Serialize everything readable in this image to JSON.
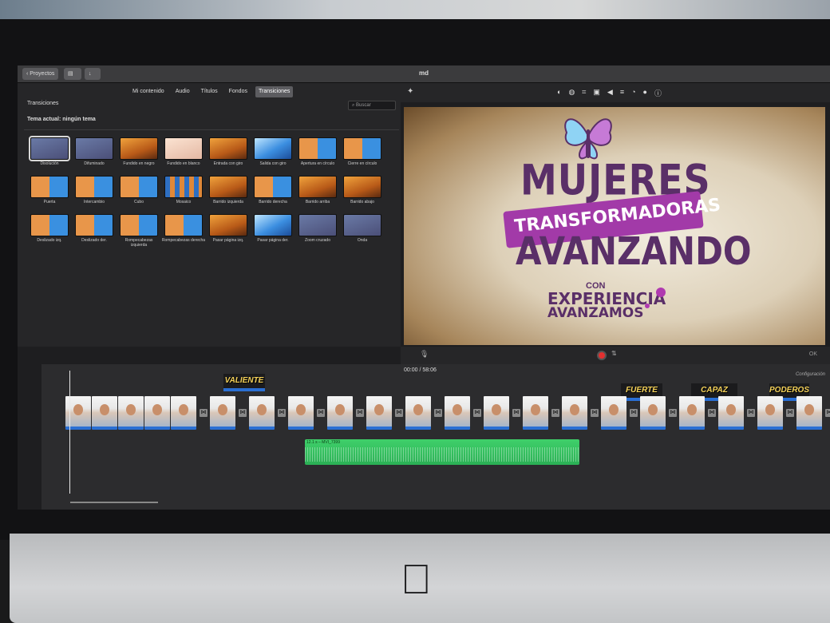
{
  "window": {
    "back_button": "Proyectos",
    "title": "md"
  },
  "browser": {
    "tabs": [
      "Mi contenido",
      "Audio",
      "Títulos",
      "Fondos",
      "Transiciones"
    ],
    "active_tab": "Transiciones",
    "section_title": "Transiciones",
    "search_placeholder": "Buscar",
    "theme_label": "Tema actual: ningún tema",
    "transitions": [
      {
        "label": "Disolución",
        "style": "dark"
      },
      {
        "label": "Difuminado",
        "style": "dark"
      },
      {
        "label": "Fundido en negro",
        "style": "warm"
      },
      {
        "label": "Fundido en blanco",
        "style": "pale"
      },
      {
        "label": "Entrada con giro",
        "style": "warm"
      },
      {
        "label": "Salida con giro",
        "style": "blue"
      },
      {
        "label": "Apertura en círculo",
        "style": "mix"
      },
      {
        "label": "Cierre en círculo",
        "style": "mix"
      },
      {
        "label": "Puerta",
        "style": "mix"
      },
      {
        "label": "Intercambio",
        "style": "mix"
      },
      {
        "label": "Cubo",
        "style": "mix"
      },
      {
        "label": "Mosaico",
        "style": "mosaic"
      },
      {
        "label": "Barrido izquierda",
        "style": "warm"
      },
      {
        "label": "Barrido derecha",
        "style": "mix"
      },
      {
        "label": "Barrido arriba",
        "style": "warm"
      },
      {
        "label": "Barrido abajo",
        "style": "warm"
      },
      {
        "label": "Deslizado izq.",
        "style": "mix"
      },
      {
        "label": "Deslizado der.",
        "style": "mix"
      },
      {
        "label": "Rompecabezas izquierda",
        "style": "mix"
      },
      {
        "label": "Rompecabezas derecha",
        "style": "mix"
      },
      {
        "label": "Pasar página izq.",
        "style": "warm"
      },
      {
        "label": "Pasar página der.",
        "style": "blue"
      },
      {
        "label": "Zoom cruzado",
        "style": "dark"
      },
      {
        "label": "Onda",
        "style": "dark"
      }
    ]
  },
  "viewer": {
    "line1": "MUJERES",
    "line2": "TRANSFORMADORAS",
    "line3": "AVANZANDO",
    "line4": "CON",
    "line5": "EXPERIENCIA",
    "line6": "AVANZAMOS",
    "done": "OK"
  },
  "timeline": {
    "time": "00:00 / 58:06",
    "config": "Configuración",
    "titles": [
      "VALIENTE",
      "FUERTE",
      "CAPAZ",
      "PODEROSA"
    ],
    "audio_label": "12.1 s – MVI_7399"
  },
  "colors": {
    "accent": "#2a6fd3",
    "title_purple": "#5a2f68",
    "banner": "#a23aa8",
    "audio": "#3fd06a"
  }
}
